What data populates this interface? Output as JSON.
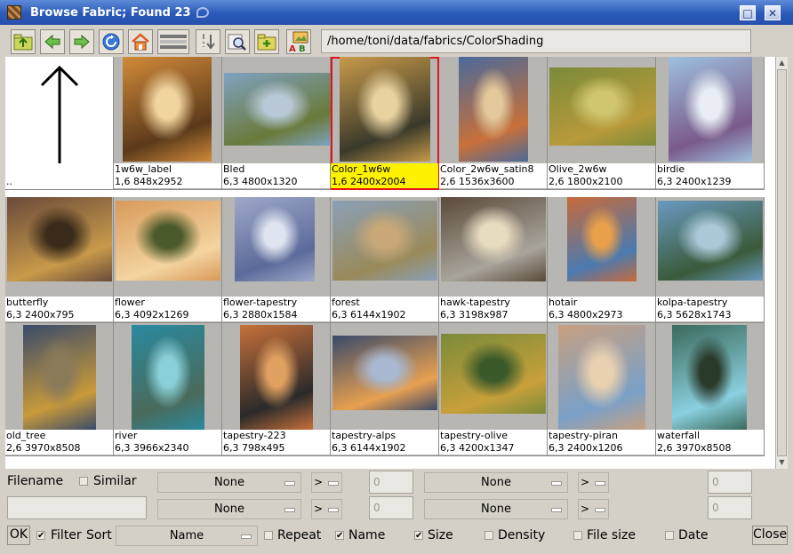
{
  "window": {
    "title": "Browse Fabric; Found 23",
    "minimize_glyph": "▫",
    "maximize_glyph": "□",
    "close_glyph": "✕"
  },
  "toolbar": {
    "buttons": [
      {
        "name": "folder-up-icon"
      },
      {
        "name": "back-arrow-icon"
      },
      {
        "name": "forward-arrow-icon"
      },
      {
        "name": "refresh-icon"
      },
      {
        "name": "home-icon"
      },
      {
        "name": "view-list-icon"
      },
      {
        "name": "sort-down-icon"
      },
      {
        "name": "preview-magnifier-icon"
      },
      {
        "name": "new-folder-icon"
      },
      {
        "name": "image-rename-icon"
      }
    ],
    "path": "/home/toni/data/fabrics/ColorShading"
  },
  "thumbnails": [
    {
      "name": "",
      "info": "..",
      "kind": "up"
    },
    {
      "name": "1w6w_label",
      "info": "1,6 848x2952"
    },
    {
      "name": "Bled",
      "info": "6,3 4800x1320"
    },
    {
      "name": "Color_1w6w",
      "info": "1,6 2400x2004",
      "selected": true
    },
    {
      "name": "Color_2w6w_satin8",
      "info": "2,6 1536x3600"
    },
    {
      "name": "Olive_2w6w",
      "info": "2,6 1800x2100"
    },
    {
      "name": "birdie",
      "info": "6,3 2400x1239"
    },
    {
      "name": "butterfly",
      "info": "6,3 2400x795"
    },
    {
      "name": "flower",
      "info": "6,3 4092x1269"
    },
    {
      "name": "flower-tapestry",
      "info": "6,3 2880x1584"
    },
    {
      "name": "forest",
      "info": "6,3 6144x1902"
    },
    {
      "name": "hawk-tapestry",
      "info": "6,3 3198x987"
    },
    {
      "name": "hotair",
      "info": "6,3 4800x2973"
    },
    {
      "name": "kolpa-tapestry",
      "info": "6,3 5628x1743"
    },
    {
      "name": "old_tree",
      "info": "2,6 3970x8508"
    },
    {
      "name": "river",
      "info": "6,3 3966x2340"
    },
    {
      "name": "tapestry-223",
      "info": "6,3 798x495"
    },
    {
      "name": "tapestry-alps",
      "info": "6,3 6144x1902"
    },
    {
      "name": "tapestry-olive",
      "info": "6,3 4200x1347"
    },
    {
      "name": "tapestry-piran",
      "info": "6,3 2400x1206"
    },
    {
      "name": "waterfall",
      "info": "2,6 3970x8508"
    }
  ],
  "filters": {
    "filename_label": "Filename",
    "similar_label": "Similar",
    "similar_checked": false,
    "filename_value": "",
    "combo_value": "None",
    "comparator": ">",
    "number_value": "0"
  },
  "bottom": {
    "ok_label": "OK",
    "filter_label": "Filter",
    "filter_checked": true,
    "sort_label": "Sort",
    "sort_value": "Name",
    "options": [
      {
        "label": "Repeat",
        "checked": false
      },
      {
        "label": "Name",
        "checked": true
      },
      {
        "label": "Size",
        "checked": true
      },
      {
        "label": "Density",
        "checked": false
      },
      {
        "label": "File size",
        "checked": false
      },
      {
        "label": "Date",
        "checked": false
      }
    ],
    "close_label": "Close"
  }
}
